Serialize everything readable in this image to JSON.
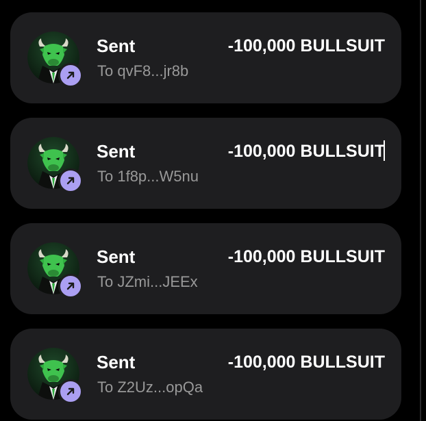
{
  "theme": {
    "background": "#000000",
    "card": "#1e1e20",
    "badge": "#ab9ff2",
    "primary_text": "#ffffff",
    "secondary_text": "#999999",
    "logo_green": "#2fae3f"
  },
  "transactions": [
    {
      "type": "Sent",
      "recipient": "To qvF8...jr8b",
      "amount": "-100,000 BULLSUIT",
      "token_icon": "bull-suit-logo-icon",
      "badge_icon": "arrow-up-right-icon"
    },
    {
      "type": "Sent",
      "recipient": "To 1f8p...W5nu",
      "amount": "-100,000 BULLSUIT",
      "token_icon": "bull-suit-logo-icon",
      "badge_icon": "arrow-up-right-icon"
    },
    {
      "type": "Sent",
      "recipient": "To JZmi...JEEx",
      "amount": "-100,000 BULLSUIT",
      "token_icon": "bull-suit-logo-icon",
      "badge_icon": "arrow-up-right-icon"
    },
    {
      "type": "Sent",
      "recipient": "To Z2Uz...opQa",
      "amount": "-100,000 BULLSUIT",
      "token_icon": "bull-suit-logo-icon",
      "badge_icon": "arrow-up-right-icon"
    }
  ]
}
